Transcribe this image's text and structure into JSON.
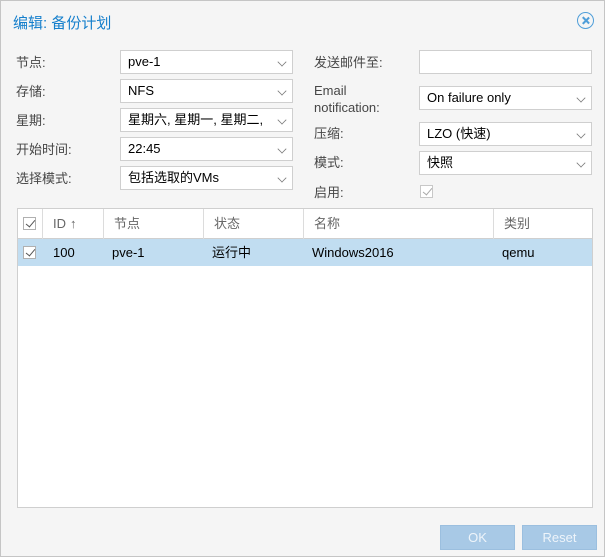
{
  "dialog": {
    "title": "编辑: 备份计划"
  },
  "form_left": [
    {
      "label": "节点:",
      "value": "pve-1"
    },
    {
      "label": "存储:",
      "value": "NFS"
    },
    {
      "label": "星期:",
      "value": "星期六, 星期一, 星期二,"
    },
    {
      "label": "开始时间:",
      "value": "22:45"
    },
    {
      "label": "选择模式:",
      "value": "包括选取的VMs"
    }
  ],
  "form_right": {
    "email_to_label": "发送邮件至:",
    "email_to_value": "",
    "email_notification_label_1": "Email",
    "email_notification_label_2": "notification:",
    "email_notification_value": "On failure only",
    "compression_label": "压缩:",
    "compression_value": "LZO (快速)",
    "mode_label": "模式:",
    "mode_value": "快照",
    "enabled_label": "启用:",
    "enabled_checked": true
  },
  "grid": {
    "columns": [
      "ID",
      "节点",
      "状态",
      "名称",
      "类别"
    ],
    "sort_indicator": "↑",
    "rows": [
      {
        "checked": true,
        "id": "100",
        "node": "pve-1",
        "status": "运行中",
        "name": "Windows2016",
        "type": "qemu"
      }
    ]
  },
  "buttons": {
    "ok": "OK",
    "reset": "Reset"
  },
  "colors": {
    "accent": "#157fcc",
    "selected_row": "#c1ddf1",
    "button_disabled": "#a8c9e6"
  }
}
